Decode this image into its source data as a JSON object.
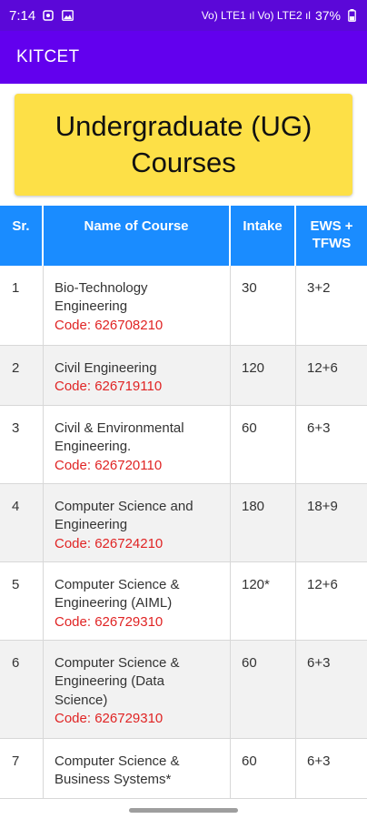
{
  "status_bar": {
    "time": "7:14",
    "network": "Vo) LTE1 ıl Vo) LTE2 ıl",
    "battery": "37%"
  },
  "app_bar": {
    "title": "KITCET"
  },
  "banner": {
    "title": "Undergraduate (UG) Courses"
  },
  "table": {
    "headers": {
      "sr": "Sr.",
      "name": "Name of Course",
      "intake": "Intake",
      "ews": "EWS + TFWS"
    },
    "rows": [
      {
        "sr": "1",
        "name": "Bio-Technology Engineering",
        "code": "Code: 626708210",
        "intake": "30",
        "ews": "3+2"
      },
      {
        "sr": "2",
        "name": "Civil Engineering",
        "code": "Code: 626719110",
        "intake": "120",
        "ews": "12+6"
      },
      {
        "sr": "3",
        "name": "Civil & Environmental Engineering.",
        "code": "Code: 626720110",
        "intake": "60",
        "ews": "6+3"
      },
      {
        "sr": "4",
        "name": "Computer Science and Engineering",
        "code": "Code: 626724210",
        "intake": "180",
        "ews": "18+9"
      },
      {
        "sr": "5",
        "name": "Computer Science & Engineering (AIML)",
        "code": "Code: 626729310",
        "intake": "120*",
        "ews": "12+6"
      },
      {
        "sr": "6",
        "name": "Computer Science & Engineering (Data Science)",
        "code": "Code: 626729310",
        "intake": "60",
        "ews": "6+3"
      },
      {
        "sr": "7",
        "name": "Computer Science & Business Systems*",
        "code": "",
        "intake": "60",
        "ews": "6+3"
      }
    ]
  },
  "colors": {
    "status_bar": "#5b08d8",
    "app_bar": "#6200ee",
    "banner": "#fde047",
    "table_header": "#1a8cff",
    "course_code": "#e02424"
  }
}
